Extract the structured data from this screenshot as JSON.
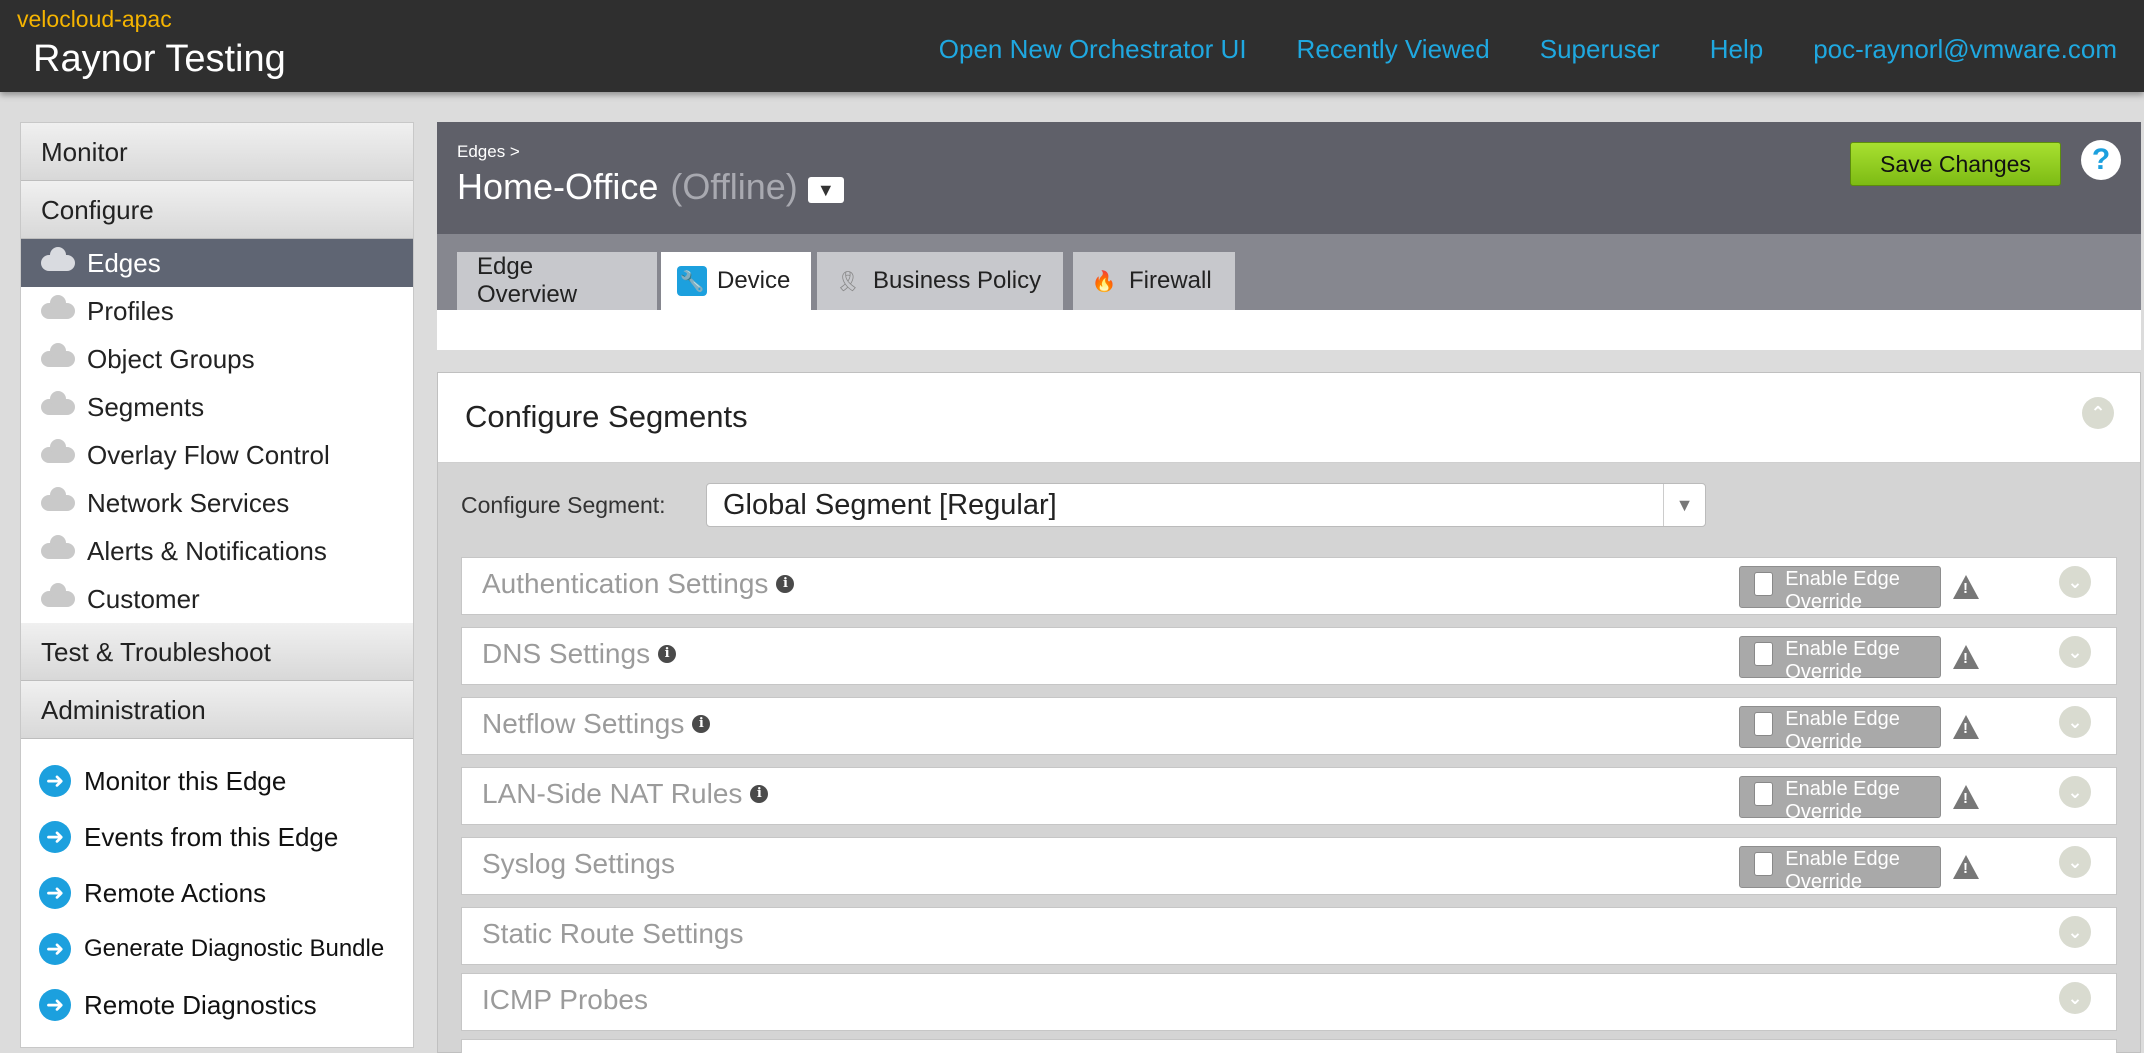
{
  "header": {
    "tenant": "velocloud-apac",
    "customer": "Raynor Testing",
    "nav": [
      "Open New Orchestrator UI",
      "Recently Viewed",
      "Superuser",
      "Help",
      "poc-raynorl@vmware.com"
    ]
  },
  "sidebar": {
    "sections": {
      "monitor": "Monitor",
      "configure": "Configure",
      "test": "Test & Troubleshoot",
      "admin": "Administration"
    },
    "items": [
      "Edges",
      "Profiles",
      "Object Groups",
      "Segments",
      "Overlay Flow Control",
      "Network Services",
      "Alerts & Notifications",
      "Customer"
    ],
    "actions": [
      "Monitor this Edge",
      "Events from this Edge",
      "Remote Actions",
      "Generate Diagnostic Bundle",
      "Remote Diagnostics"
    ]
  },
  "edge": {
    "breadcrumb": "Edges >",
    "name": "Home-Office",
    "status": "(Offline)",
    "save_label": "Save Changes",
    "help": "?"
  },
  "tabs": [
    "Edge Overview",
    "Device",
    "Business Policy",
    "Firewall"
  ],
  "panel": {
    "title": "Configure Segments",
    "segment_label": "Configure Segment:",
    "segment_value": "Global Segment [Regular]",
    "override_label": "Enable Edge Override",
    "settings": [
      "Authentication Settings",
      "DNS Settings",
      "Netflow Settings",
      "LAN-Side NAT Rules",
      "Syslog Settings",
      "Static Route Settings",
      "ICMP Probes"
    ]
  },
  "colors": {
    "accent": "#1fa8e0",
    "tenant": "#f5b400",
    "save": "#8fcc1e"
  }
}
